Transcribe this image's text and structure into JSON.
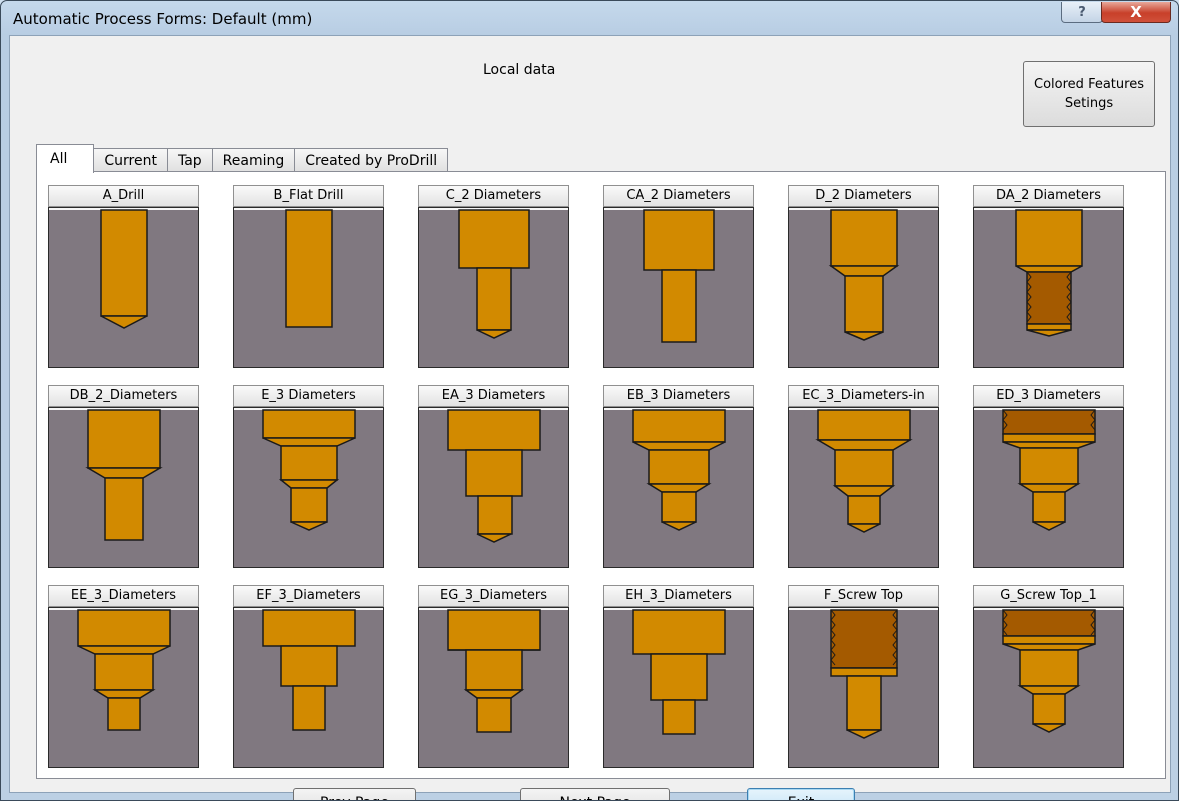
{
  "window": {
    "title": "Automatic Process Forms: Default (mm)",
    "help_label": "?",
    "close_label": "X"
  },
  "header": {
    "local_data_label": "Local data",
    "colored_features_label": "Colored Features Setings"
  },
  "tabs": [
    {
      "label": "All"
    },
    {
      "label": "Current"
    },
    {
      "label": "Tap"
    },
    {
      "label": "Reaming"
    },
    {
      "label": "Created by ProDrill"
    }
  ],
  "forms": [
    {
      "label": "A_Drill",
      "icon": "drill-form-icon"
    },
    {
      "label": "B_Flat Drill",
      "icon": "flat-drill-form-icon"
    },
    {
      "label": "C_2 Diameters",
      "icon": "two-diameter-form-icon"
    },
    {
      "label": "CA_2 Diameters",
      "icon": "two-diameter-form-icon"
    },
    {
      "label": "D_2 Diameters",
      "icon": "two-diameter-chamfer-form-icon"
    },
    {
      "label": "DA_2 Diameters",
      "icon": "two-diameter-thread-form-icon"
    },
    {
      "label": "DB_2_Diameters",
      "icon": "two-diameter-chamfer-form-icon"
    },
    {
      "label": "E_3 Diameters",
      "icon": "three-diameter-form-icon"
    },
    {
      "label": "EA_3 Diameters",
      "icon": "three-diameter-form-icon"
    },
    {
      "label": "EB_3 Diameters",
      "icon": "three-diameter-chamfer-form-icon"
    },
    {
      "label": "EC_3_Diameters-in",
      "icon": "three-diameter-chamfer-form-icon"
    },
    {
      "label": "ED_3 Diameters",
      "icon": "three-diameter-thread-form-icon"
    },
    {
      "label": "EE_3_Diameters",
      "icon": "three-diameter-chamfer-form-icon"
    },
    {
      "label": "EF_3_Diameters",
      "icon": "three-diameter-form-icon"
    },
    {
      "label": "EG_3_Diameters",
      "icon": "three-diameter-form-icon"
    },
    {
      "label": "EH_3_Diameters",
      "icon": "three-diameter-form-icon"
    },
    {
      "label": "F_Screw Top",
      "icon": "screw-top-form-icon"
    },
    {
      "label": "G_Screw Top_1",
      "icon": "screw-top-three-diameter-form-icon"
    }
  ],
  "buttons": {
    "prev_label": "Prev Page",
    "next_label": "Next Page",
    "exit_label": "Exit"
  },
  "colors": {
    "metal": "#d28a00",
    "thread": "#a45a00",
    "background": "#807880"
  }
}
